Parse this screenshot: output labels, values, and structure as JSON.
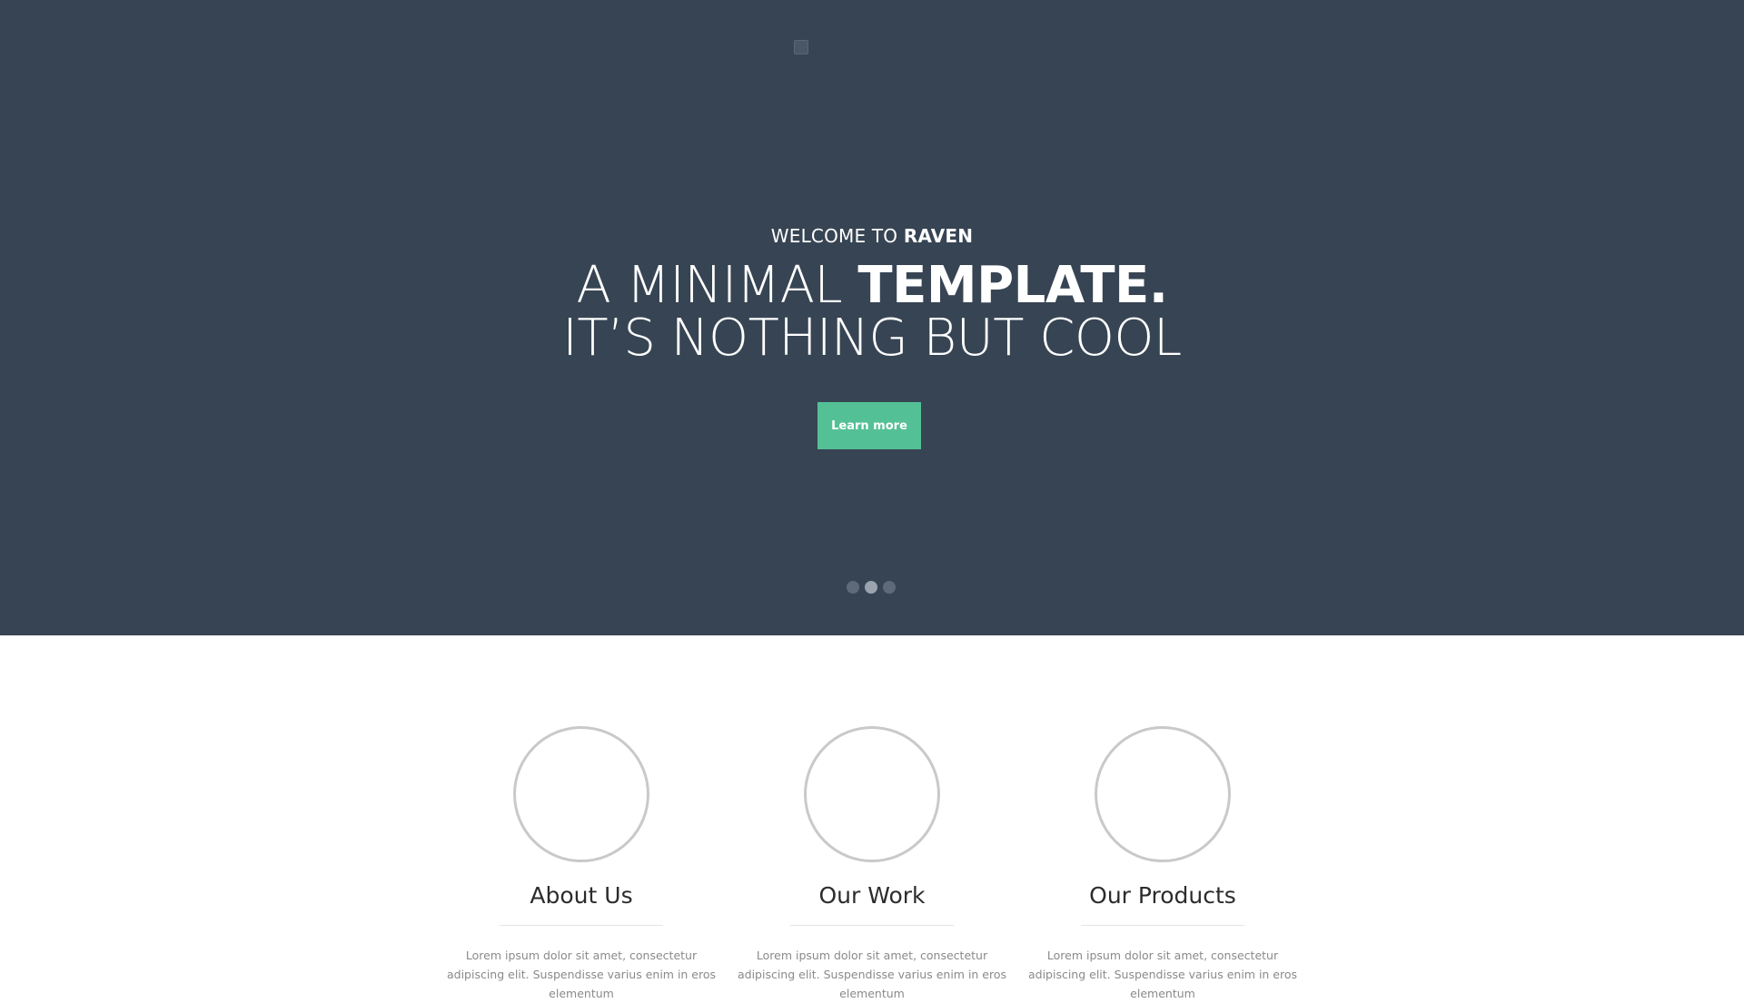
{
  "hero": {
    "welcome_prefix": "WELCOME TO ",
    "welcome_brand": "RAVEN",
    "headline_light": "A MINIMAL ",
    "headline_bold": "TEMPLATE.",
    "headline_line2": "IT’S NOTHING BUT COOL",
    "button_label": "Learn more",
    "slides": [
      {
        "active": false
      },
      {
        "active": true
      },
      {
        "active": false
      }
    ],
    "background_color": "#374453",
    "accent_color": "#54c096"
  },
  "features": [
    {
      "title": "About Us",
      "text": "Lorem ipsum dolor sit amet, consectetur adipiscing elit. Suspendisse varius enim in eros elementum"
    },
    {
      "title": "Our Work",
      "text": "Lorem ipsum dolor sit amet, consectetur adipiscing elit. Suspendisse varius enim in eros elementum"
    },
    {
      "title": "Our Products",
      "text": "Lorem ipsum dolor sit amet, consectetur adipiscing elit. Suspendisse varius enim in eros elementum"
    }
  ]
}
